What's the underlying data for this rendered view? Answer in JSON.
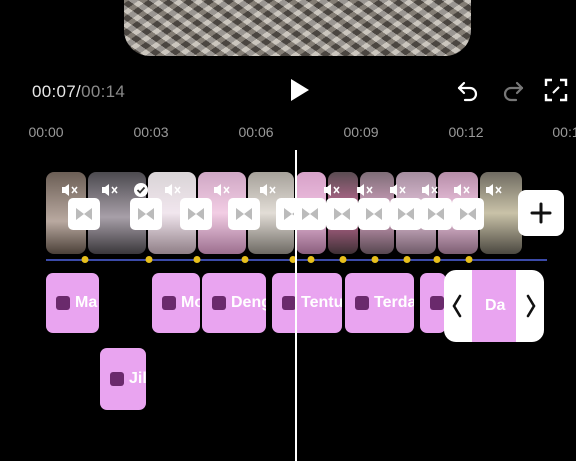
{
  "player": {
    "current_time": "00:07",
    "separator": "/",
    "total_time": "00:14"
  },
  "ruler": {
    "ticks": [
      "00:00",
      "00:03",
      "00:06",
      "00:09",
      "00:12",
      "00:1"
    ]
  },
  "controls": {
    "play": "play-icon",
    "undo": "undo-icon",
    "redo": "redo-icon",
    "fullscreen": "fullscreen-icon",
    "add_clip": "plus-icon"
  },
  "text_chips": [
    "Ma",
    "Mo",
    "Deng",
    "Tentu",
    "Terda",
    "Da",
    "Jil"
  ],
  "colors": {
    "background": "#000000",
    "text_chip": "#e9a4f0",
    "keyframe_dot": "#e8c01c",
    "track_line": "#3b4aa8",
    "playhead": "#ffffff"
  }
}
